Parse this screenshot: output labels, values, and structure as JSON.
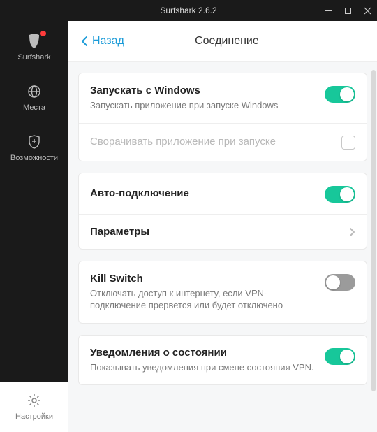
{
  "titlebar": {
    "title": "Surfshark 2.6.2"
  },
  "sidebar": {
    "items": [
      {
        "label": "Surfshark"
      },
      {
        "label": "Места"
      },
      {
        "label": "Возможности"
      },
      {
        "label": "Настройки"
      }
    ]
  },
  "header": {
    "back_label": "Назад",
    "title": "Соединение"
  },
  "settings": {
    "launch": {
      "title": "Запускать с Windows",
      "subtitle": "Запускать приложение при запуске Windows",
      "on": true
    },
    "minimize": {
      "label": "Сворачивать приложение при запуске",
      "checked": false
    },
    "autoconnect": {
      "title": "Авто-подключение",
      "on": true,
      "params_label": "Параметры"
    },
    "killswitch": {
      "title": "Kill Switch",
      "subtitle": "Отключать доступ к интернету, если VPN-подключение прервется или будет отключено",
      "on": false
    },
    "notifications": {
      "title": "Уведомления о состоянии",
      "subtitle": "Показывать уведомления при смене состояния VPN.",
      "on": true
    }
  },
  "colors": {
    "accent": "#17c79a",
    "link": "#1b9bd8",
    "sidebar_bg": "#1a1a1a"
  }
}
